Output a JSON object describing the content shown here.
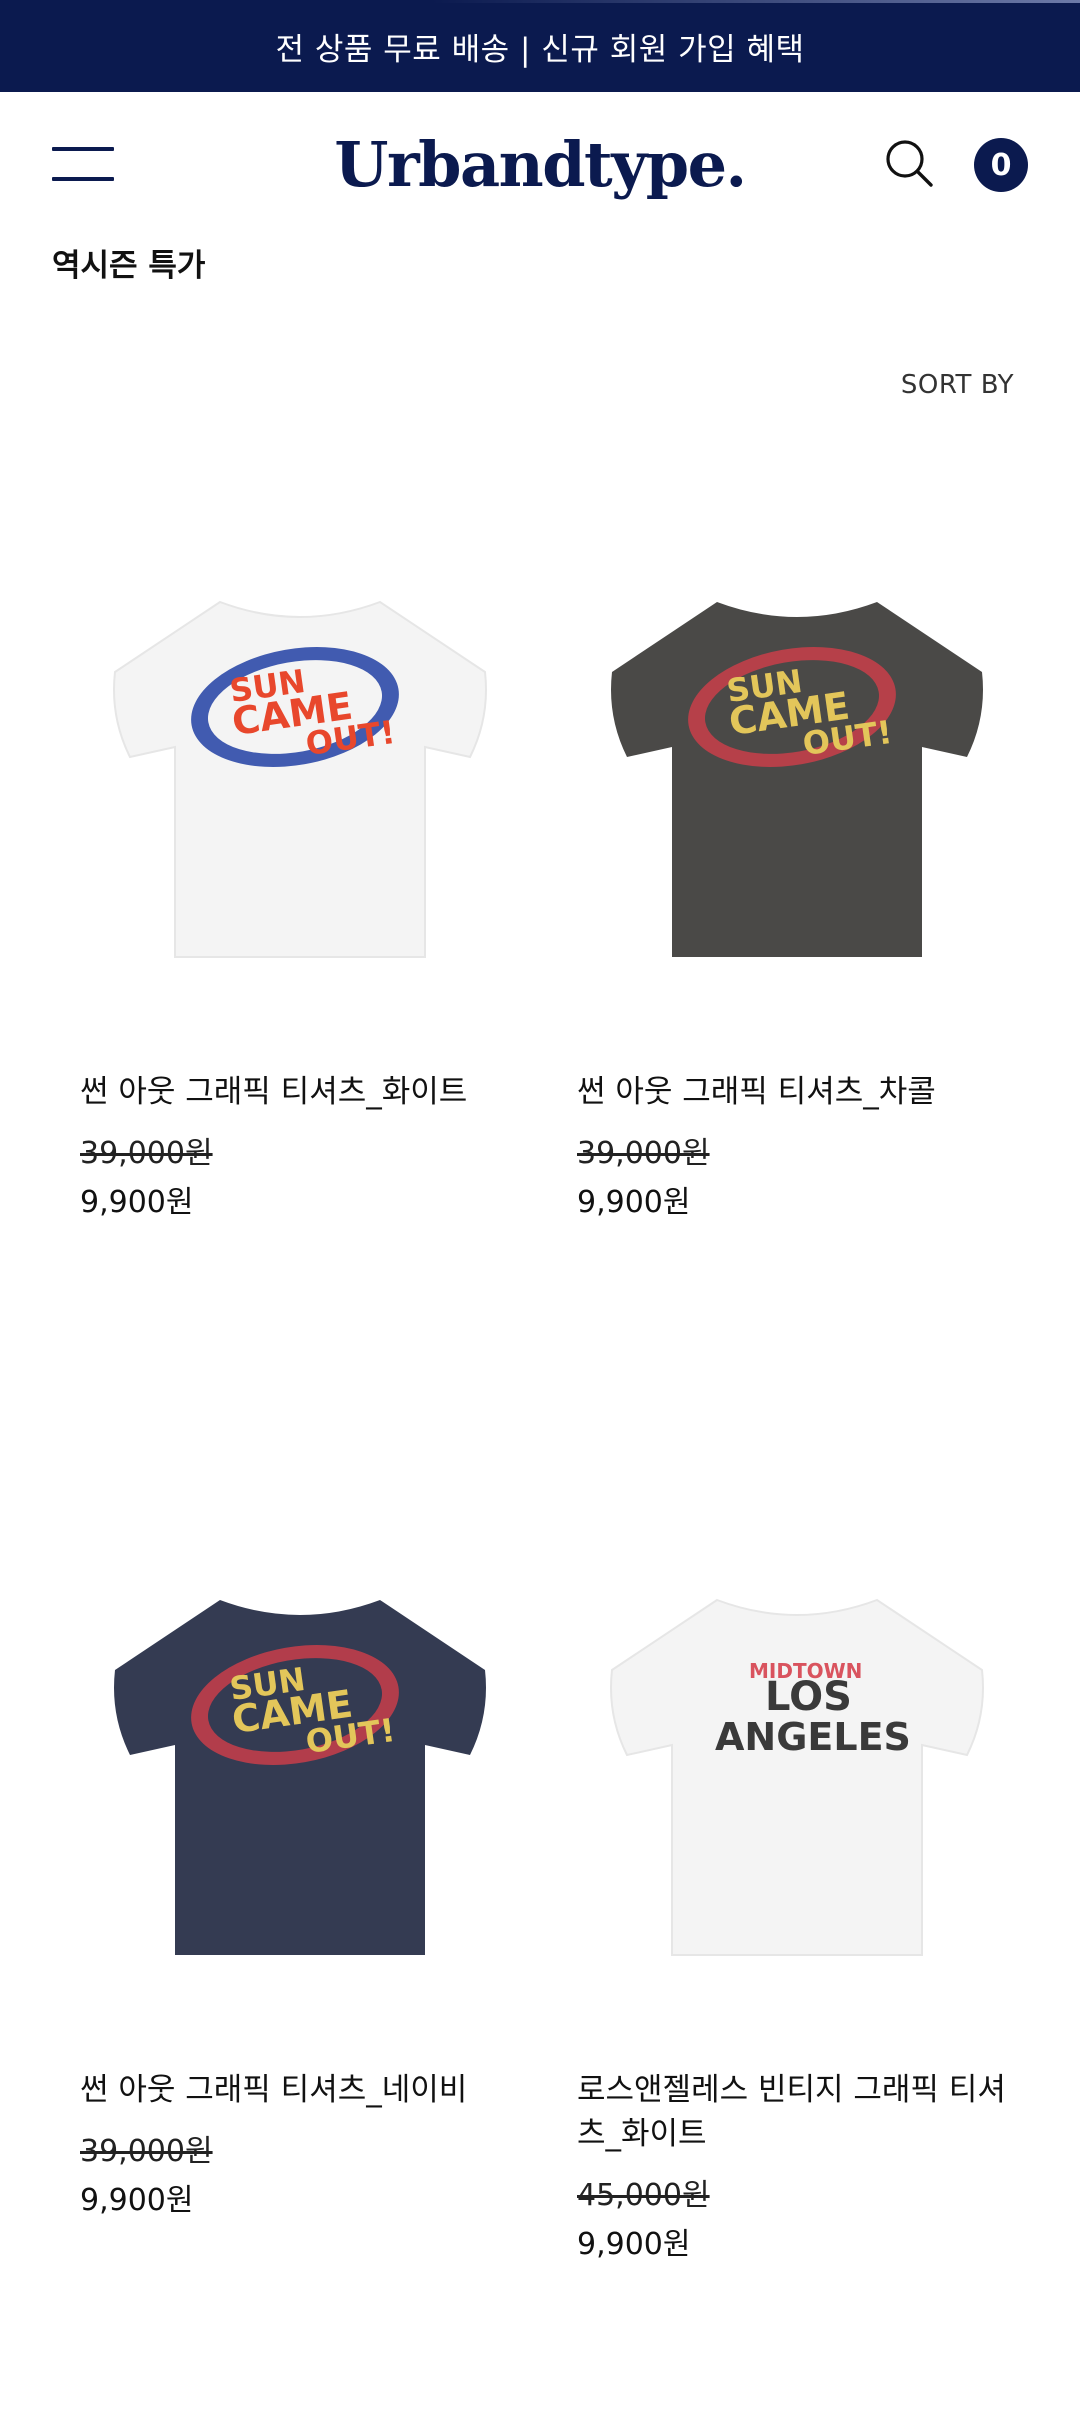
{
  "promo": {
    "text": "전 상품 무료 배송 | 신규 회원 가입 혜택"
  },
  "header": {
    "logo": "Urbandtype.",
    "menu_icon": "hamburger-menu-icon",
    "search_icon": "search-icon",
    "cart_count": "0"
  },
  "page": {
    "title": "역시즌 특가",
    "sort_label": "SORT BY"
  },
  "colors": {
    "brand_navy": "#0b1a4f"
  },
  "products": [
    {
      "name": "썬 아웃 그래픽 티셔츠_화이트",
      "original_price": "39,000원",
      "sale_price": "9,900원",
      "shirt_color": "#f4f4f4",
      "print": [
        "SUN",
        "CAME",
        "OUT!"
      ]
    },
    {
      "name": "썬 아웃 그래픽 티셔츠_차콜",
      "original_price": "39,000원",
      "sale_price": "9,900원",
      "shirt_color": "#4a4947",
      "print": [
        "SUN",
        "CAME",
        "OUT!"
      ]
    },
    {
      "name": "썬 아웃 그래픽 티셔츠_네이비",
      "original_price": "39,000원",
      "sale_price": "9,900원",
      "shirt_color": "#343b52",
      "print": [
        "SUN",
        "CAME",
        "OUT!"
      ]
    },
    {
      "name": "로스앤젤레스 빈티지 그래픽 티셔츠_화이트",
      "original_price": "45,000원",
      "sale_price": "9,900원",
      "shirt_color": "#f4f4f4",
      "print": [
        "MIDTOWN",
        "LOS",
        "ANGELES"
      ]
    }
  ]
}
